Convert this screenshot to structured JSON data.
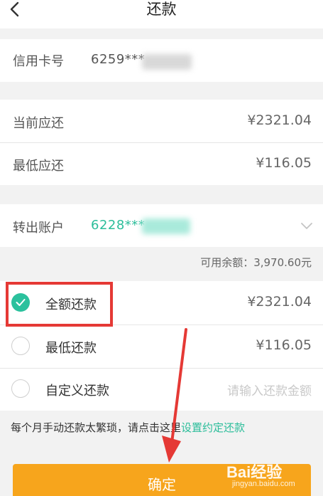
{
  "header": {
    "title": "还款",
    "back_icon": "chevron-left-icon"
  },
  "card": {
    "label": "信用卡号",
    "value": "6259***"
  },
  "due": {
    "current_label": "当前应还",
    "current_amount": "¥2321.04",
    "minimum_label": "最低应还",
    "minimum_amount": "¥116.05"
  },
  "transfer": {
    "label": "转出账户",
    "account": "6228***",
    "dropdown_icon": "chevron-down-icon"
  },
  "balance": "可用余额：3,970.60元",
  "options": [
    {
      "label": "全额还款",
      "amount": "¥2321.04",
      "checked": true
    },
    {
      "label": "最低还款",
      "amount": "¥116.05",
      "checked": false
    },
    {
      "label": "自定义还款",
      "placeholder": "请输入还款金额",
      "checked": false
    }
  ],
  "hint": {
    "text": "每个月手动还款太繁琐，请点击这里",
    "link": "设置约定还款"
  },
  "confirm_label": "确定",
  "watermark": {
    "brand": "Bai经验",
    "site": "jingyan.baidu.com"
  },
  "colors": {
    "accent": "#2bc19d",
    "button": "#f7a51c",
    "highlight": "#e53935"
  }
}
